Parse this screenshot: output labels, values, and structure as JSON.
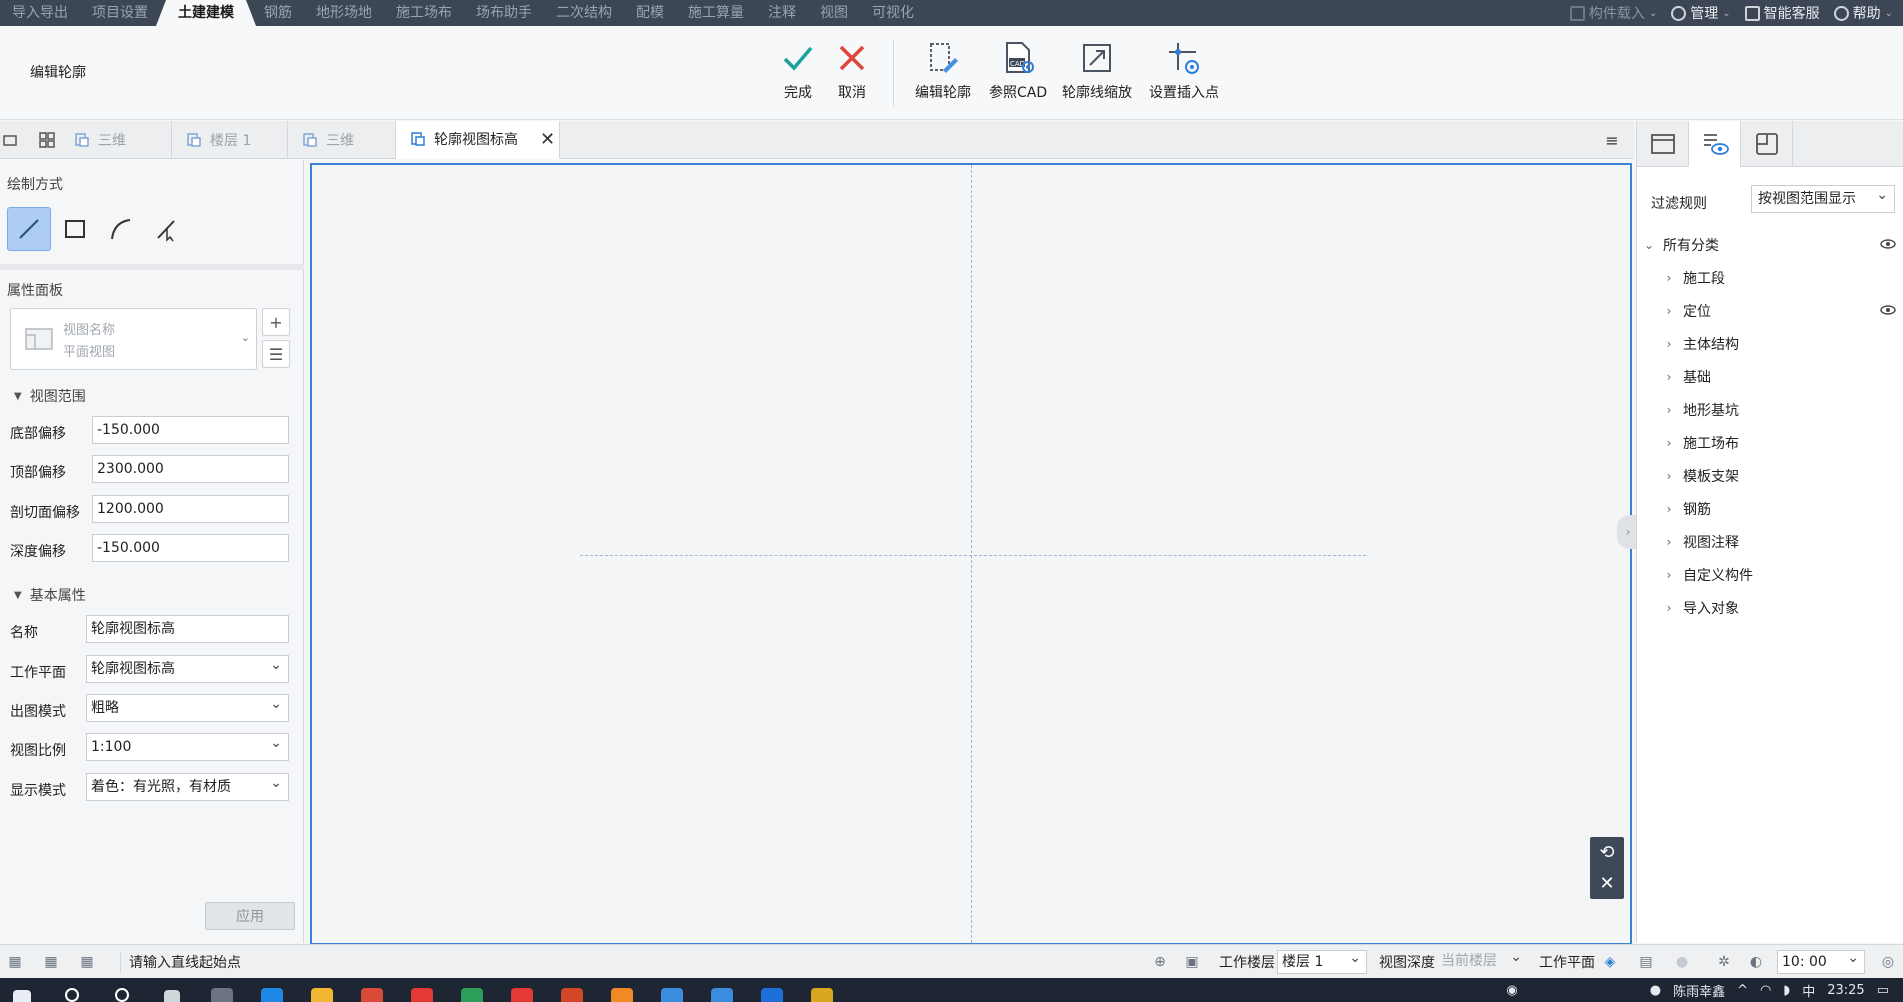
{
  "menubar": {
    "tabs": [
      "导入导出",
      "项目设置",
      "土建建模",
      "钢筋",
      "地形场地",
      "施工场布",
      "场布助手",
      "二次结构",
      "配模",
      "施工算量",
      "注释",
      "视图",
      "可视化"
    ],
    "active_index": 2,
    "right": {
      "component_load": "构件载入",
      "manage": "管理",
      "service": "智能客服",
      "help": "帮助"
    }
  },
  "ribbon": {
    "title": "编辑轮廓",
    "buttons": {
      "finish": "完成",
      "cancel": "取消",
      "edit_contour": "编辑轮廓",
      "ref_cad": "参照CAD",
      "contour_scale": "轮廓线缩放",
      "set_insert_point": "设置插入点"
    },
    "colors": {
      "finish": "#1aa39a",
      "cancel": "#e0443a"
    }
  },
  "tabstrip": {
    "tabs": [
      {
        "label": "三维",
        "active": false
      },
      {
        "label": "楼层 1",
        "active": false
      },
      {
        "label": "三维",
        "active": false
      },
      {
        "label": "轮廓视图标高",
        "active": true
      }
    ]
  },
  "left_panel": {
    "draw_mode_title": "绘制方式",
    "draw_tools": [
      "line-tool",
      "rectangle-tool",
      "arc-tool",
      "point-arc-tool"
    ],
    "property_panel_title": "属性面板",
    "view_picker": {
      "line1": "视图名称",
      "line2": "平面视图"
    },
    "group_view_range": "视图范围",
    "view_range": [
      {
        "label": "底部偏移",
        "value": "-150.000"
      },
      {
        "label": "顶部偏移",
        "value": "2300.000"
      },
      {
        "label": "剖切面偏移",
        "value": "1200.000"
      },
      {
        "label": "深度偏移",
        "value": "-150.000"
      }
    ],
    "group_basic": "基本属性",
    "basic": [
      {
        "label": "名称",
        "value": "轮廓视图标高",
        "type": "input"
      },
      {
        "label": "工作平面",
        "value": "轮廓视图标高",
        "type": "select"
      },
      {
        "label": "出图模式",
        "value": "粗略",
        "type": "select"
      },
      {
        "label": "视图比例",
        "value": "1:100",
        "type": "select"
      },
      {
        "label": "显示模式",
        "value": "着色：有光照，有材质",
        "type": "select"
      }
    ],
    "apply": "应用"
  },
  "right_panel": {
    "filter_label": "过滤规则",
    "filter_value": "按视图范围显示",
    "tree_root": "所有分类",
    "tree_items": [
      "施工段",
      "定位",
      "主体结构",
      "基础",
      "地形基坑",
      "施工场布",
      "模板支架",
      "钢筋",
      "视图注释",
      "自定义构件",
      "导入对象"
    ]
  },
  "statusbar": {
    "prompt": "请输入直线起始点",
    "work_floor_label": "工作楼层",
    "work_floor_value": "楼层 1",
    "view_depth_label": "视图深度",
    "view_depth_value": "当前楼层",
    "work_plane_label": "工作平面",
    "time_value": "10: 00"
  },
  "taskbar": {
    "user": "陈雨幸鑫",
    "ime": "中",
    "clock": "23:25"
  }
}
